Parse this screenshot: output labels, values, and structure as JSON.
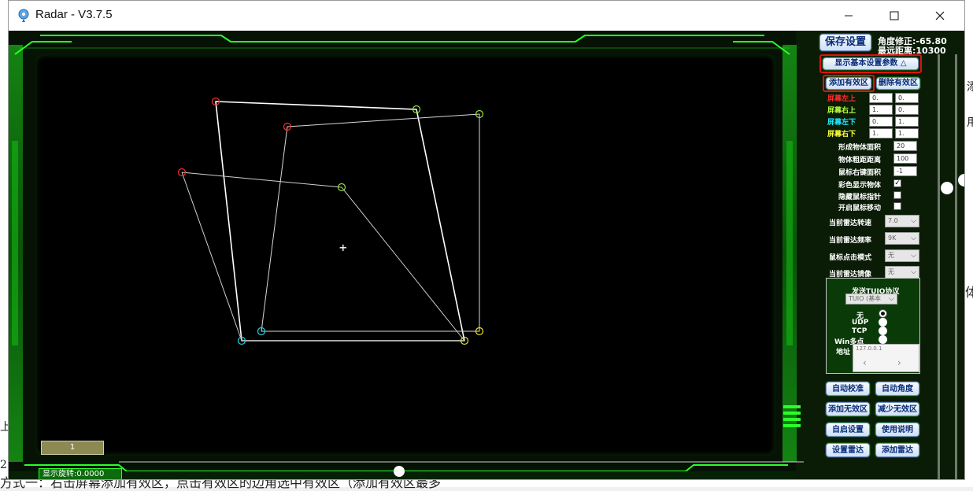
{
  "window": {
    "title": "Radar - V3.7.5"
  },
  "background_doc": {
    "bottom_line": "方式一：右击屏幕添加有效区，点击有效区的边角选中有效区（添加有效区最多",
    "prefix": "2.",
    "right_frag_1": "添",
    "right_frag_2": "用",
    "right_frag_3": "体",
    "left_frag": "上"
  },
  "panel": {
    "save_button": "保存设置",
    "angle_correction": "角度修正:-65.80",
    "max_distance": "最远距离:10300",
    "show_settings_toggle": "显示基本设置参数 △",
    "add_valid_zone": "添加有效区",
    "delete_valid_zone": "删除有效区",
    "corners": [
      {
        "label": "屏幕左上",
        "color": "#ff2a2a",
        "x": "0.",
        "y": "0."
      },
      {
        "label": "屏幕右上",
        "color": "#b8ff3c",
        "x": "1.",
        "y": "0."
      },
      {
        "label": "屏幕左下",
        "color": "#21e8ff",
        "x": "0.",
        "y": "1."
      },
      {
        "label": "屏幕右下",
        "color": "#ffff3a",
        "x": "1.",
        "y": "1."
      }
    ],
    "params": [
      {
        "label": "形成物体面积",
        "value": "20"
      },
      {
        "label": "物体粗距距离",
        "value": "100"
      },
      {
        "label": "鼠标右键面积",
        "value": "-1"
      }
    ],
    "checks": [
      {
        "label": "彩色显示物体",
        "checked": true
      },
      {
        "label": "隐藏鼠标指针",
        "checked": false
      },
      {
        "label": "开启鼠标移动",
        "checked": false
      }
    ],
    "dropdowns": [
      {
        "label": "当前雷达转速",
        "value": "7.0"
      },
      {
        "label": "当前雷达频率",
        "value": "9K"
      },
      {
        "label": "鼠标点击模式",
        "value": "无"
      },
      {
        "label": "当前雷达镜像",
        "value": "无"
      }
    ],
    "tuio": {
      "title": "发送TUIO协议",
      "select_value": "TUIO (基本",
      "options": [
        "无",
        "UDP",
        "TCP",
        "Win多点"
      ],
      "selected_index": 0,
      "address_label": "地址",
      "address_value": "127.0.0.1"
    },
    "buttons": [
      "自动校准",
      "自动角度",
      "添加无效区",
      "减少无效区",
      "自启设置",
      "使用说明",
      "设置雷达",
      "添加雷达"
    ]
  },
  "canvas": {
    "badge": "1",
    "rotation_readout": "显示旋转:0.0000",
    "crosshair": "+"
  },
  "colors": {
    "tl": "#ff2a2a",
    "tr": "#8fe33a",
    "bl": "#21d6e6",
    "br": "#e8e81a",
    "hud_green": "#19d41a",
    "panel_bg": "#0a1c06"
  }
}
